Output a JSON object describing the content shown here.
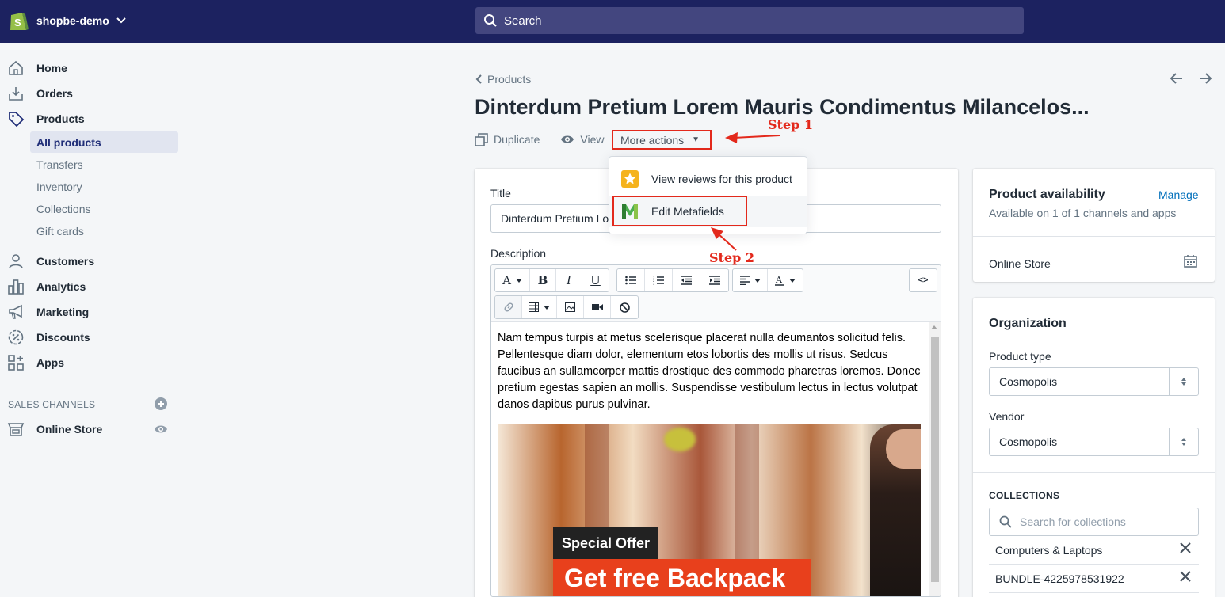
{
  "topbar": {
    "store_name": "shopbe-demo",
    "search_placeholder": "Search"
  },
  "sidebar": {
    "items": [
      {
        "label": "Home",
        "icon": "home-icon"
      },
      {
        "label": "Orders",
        "icon": "orders-icon"
      },
      {
        "label": "Products",
        "icon": "tag-icon"
      },
      {
        "label": "Customers",
        "icon": "customer-icon"
      },
      {
        "label": "Analytics",
        "icon": "analytics-icon"
      },
      {
        "label": "Marketing",
        "icon": "megaphone-icon"
      },
      {
        "label": "Discounts",
        "icon": "discount-icon"
      },
      {
        "label": "Apps",
        "icon": "apps-icon"
      }
    ],
    "product_subitems": [
      "All products",
      "Transfers",
      "Inventory",
      "Collections",
      "Gift cards"
    ],
    "sales_channels_heading": "SALES CHANNELS",
    "online_store": "Online Store"
  },
  "header": {
    "breadcrumb": "Products",
    "title": "Dinterdum Pretium Lorem Mauris Condimentus Milancelos...",
    "duplicate": "Duplicate",
    "view": "View",
    "more_actions": "More actions"
  },
  "annotations": {
    "step1": "Step 1",
    "step2": "Step 2",
    "color": "#e3291c"
  },
  "dropdown": {
    "items": [
      {
        "label": "View reviews for this product",
        "icon": "star-icon"
      },
      {
        "label": "Edit Metafields",
        "icon": "metafields-logo-icon"
      }
    ]
  },
  "form": {
    "title_label": "Title",
    "title_value": "Dinterdum Pretium Lorem Mauris Condimentus Milancelos",
    "description_label": "Description",
    "description_text": "Nam tempus turpis at metus scelerisque placerat nulla deumantos solicitud felis. Pellentesque diam dolor, elementum etos lobortis des mollis ut risus. Sedcus faucibus an sullamcorper mattis drostique des commodo pharetras loremos. Donec pretium egestas sapien an mollis. Suspendisse vestibulum lectus in lectus volutpat danos dapibus purus pulvinar.",
    "promo_special": "Special Offer",
    "promo_headline": "Get free Backpack",
    "html_toggle": "<>"
  },
  "availability": {
    "title": "Product availability",
    "manage": "Manage",
    "subtitle": "Available on 1 of 1 channels and apps",
    "channel": "Online Store"
  },
  "organization": {
    "title": "Organization",
    "product_type_label": "Product type",
    "product_type_value": "Cosmopolis",
    "vendor_label": "Vendor",
    "vendor_value": "Cosmopolis",
    "collections_heading": "COLLECTIONS",
    "collections_placeholder": "Search for collections",
    "collections": [
      "Computers & Laptops",
      "BUNDLE-4225978531922"
    ]
  },
  "colors": {
    "topbar": "#1c2260",
    "accent": "#202e78",
    "link": "#006fbb",
    "highlight": "#e3291c"
  }
}
